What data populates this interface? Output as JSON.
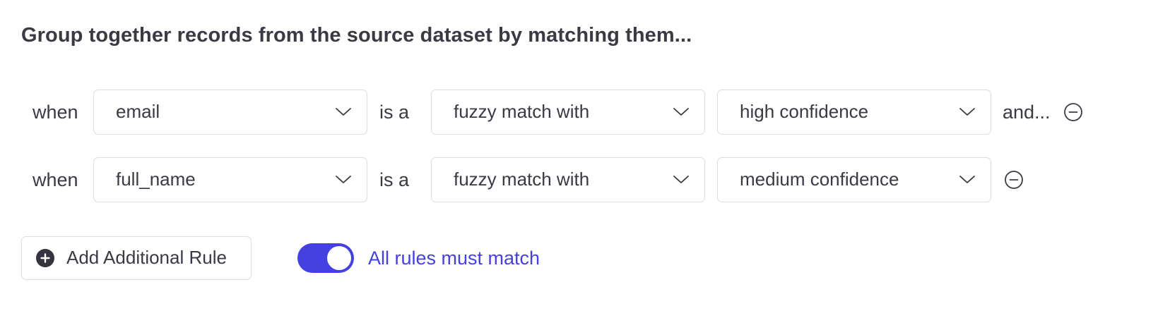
{
  "heading": "Group together records from the source dataset by matching them...",
  "rules": [
    {
      "when_label": "when",
      "field": "email",
      "connector": "is a",
      "match_type": "fuzzy match with",
      "confidence": "high confidence",
      "suffix": "and..."
    },
    {
      "when_label": "when",
      "field": "full_name",
      "connector": "is a",
      "match_type": "fuzzy match with",
      "confidence": "medium confidence"
    }
  ],
  "add_rule_label": "Add Additional Rule",
  "toggle": {
    "label": "All rules must match",
    "on": true
  },
  "colors": {
    "accent": "#4540e0",
    "text": "#3a3a44",
    "border": "#dcdce1",
    "icon": "#3a3a44"
  },
  "icons": {
    "dropdown": "chevron-down-icon",
    "remove": "minus-circle-icon",
    "add": "plus-circle-icon"
  }
}
